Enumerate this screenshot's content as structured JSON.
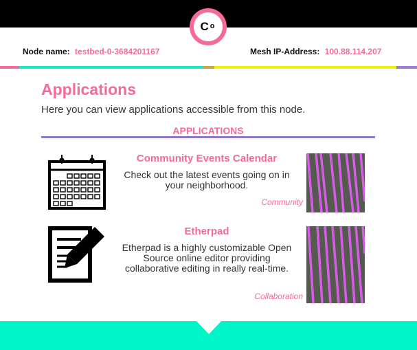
{
  "header": {
    "logo_text": "Co",
    "node_name_label": "Node name:",
    "node_name_value": "testbed-0-3684201167",
    "mesh_ip_label": "Mesh IP-Address:",
    "mesh_ip_value": "100.88.114.207"
  },
  "colors": {
    "accent_pink": "#f66a9a",
    "accent_teal": "#00f5c9",
    "accent_yellow": "#eef20d",
    "accent_purple": "#8d79cc",
    "thumb_stripe": "#d65be6",
    "thumb_bg": "#555a4f"
  },
  "main": {
    "title": "Applications",
    "subtitle": "Here you can view applications accessible from this node.",
    "section_heading": "APPLICATIONS"
  },
  "applications": [
    {
      "name": "Community Events Calendar",
      "description": "Check out the latest events going on in your neighborhood.",
      "category": "Community",
      "icon": "calendar-icon"
    },
    {
      "name": "Etherpad",
      "description": "Etherpad is a highly customizable Open Source online editor providing collaborative editing in really real-time.",
      "category": "Collaboration",
      "icon": "document-edit-icon"
    }
  ]
}
